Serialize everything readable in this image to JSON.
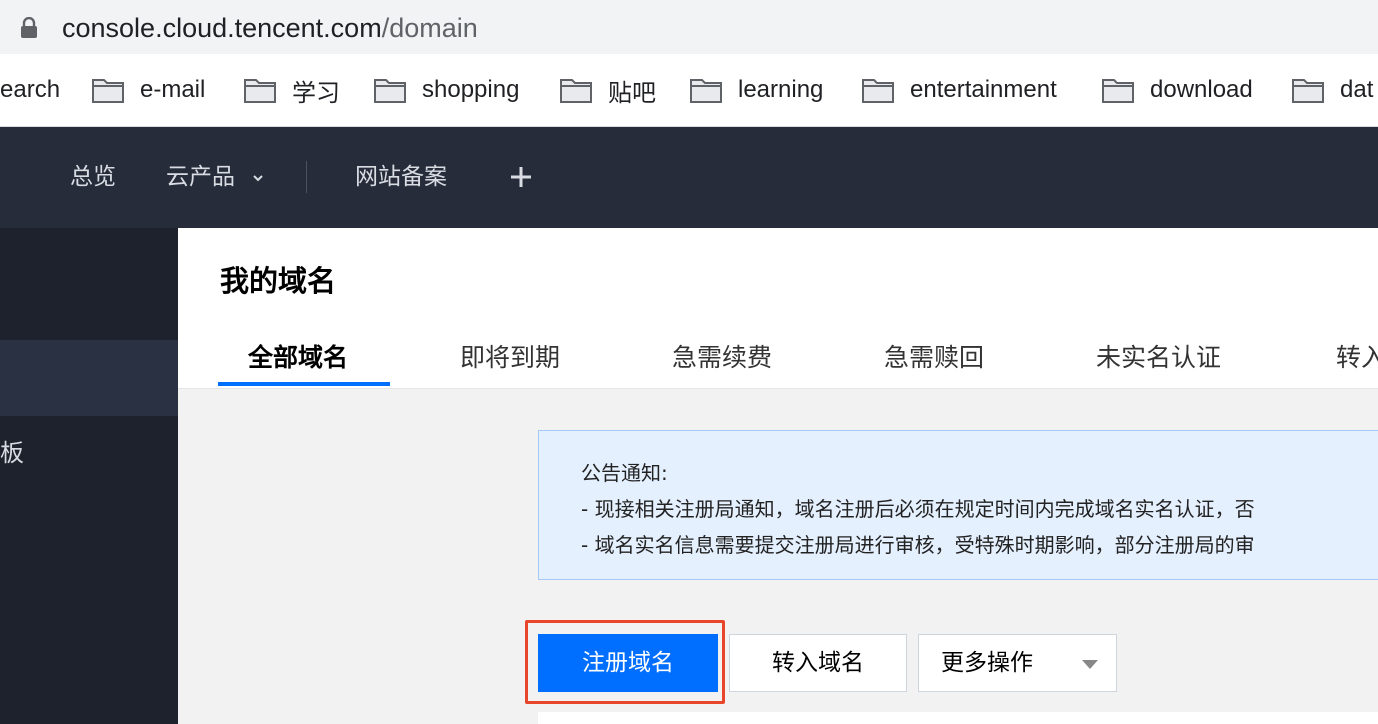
{
  "browser": {
    "url_host": "console.cloud.tencent.com",
    "url_path": "/domain"
  },
  "bookmarks": {
    "items": [
      {
        "label": "earch",
        "has_folder": false
      },
      {
        "label": "e-mail",
        "has_folder": true
      },
      {
        "label": "学习",
        "has_folder": true
      },
      {
        "label": "shopping",
        "has_folder": true
      },
      {
        "label": "贴吧",
        "has_folder": true
      },
      {
        "label": "learning",
        "has_folder": true
      },
      {
        "label": "entertainment",
        "has_folder": true
      },
      {
        "label": "download",
        "has_folder": true
      },
      {
        "label": "dat",
        "has_folder": true
      }
    ]
  },
  "topnav": {
    "overview": "总览",
    "products": "云产品",
    "beian": "网站备案"
  },
  "sidebar": {
    "partial_label": "板"
  },
  "main": {
    "title": "我的域名",
    "tabs": [
      {
        "label": "全部域名",
        "active": true
      },
      {
        "label": "即将到期",
        "active": false
      },
      {
        "label": "急需续费",
        "active": false
      },
      {
        "label": "急需赎回",
        "active": false
      },
      {
        "label": "未实名认证",
        "active": false
      },
      {
        "label": "转入",
        "active": false
      }
    ]
  },
  "notice": {
    "heading": "公告通知:",
    "line1": "- 现接相关注册局通知，域名注册后必须在规定时间内完成域名实名认证，否",
    "line2": "- 域名实名信息需要提交注册局进行审核，受特殊时期影响，部分注册局的审"
  },
  "actions": {
    "register": "注册域名",
    "transfer_in": "转入域名",
    "more": "更多操作"
  },
  "colors": {
    "nav_bg": "#262c3a",
    "sidebar_bg": "#1e222d",
    "primary": "#006eff",
    "highlight": "#e8462a",
    "notice_bg": "#e5f0ff"
  }
}
